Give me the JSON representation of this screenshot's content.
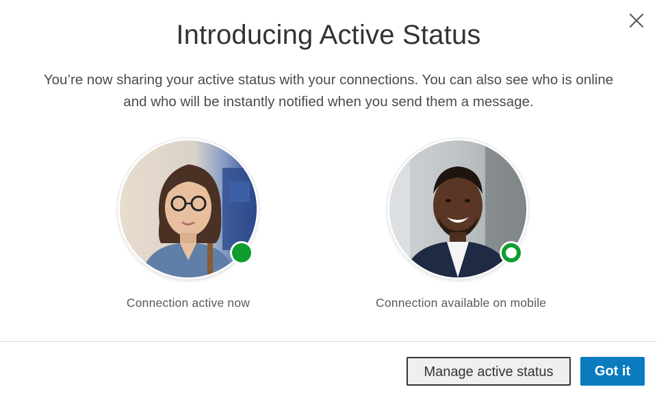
{
  "modal": {
    "title": "Introducing Active Status",
    "description": "You’re now sharing your active status with your connections. You can also see who is online and who will be instantly notified when you send them a message.",
    "close_icon": "close-icon"
  },
  "examples": [
    {
      "caption": "Connection active now",
      "status": "active",
      "status_color": "#0f9d2f"
    },
    {
      "caption": "Connection available on mobile",
      "status": "mobile",
      "status_color": "#0f9d2f"
    }
  ],
  "footer": {
    "manage_label": "Manage active status",
    "confirm_label": "Got it"
  },
  "colors": {
    "primary_button": "#0a7bbf",
    "presence_green": "#0f9d2f"
  }
}
